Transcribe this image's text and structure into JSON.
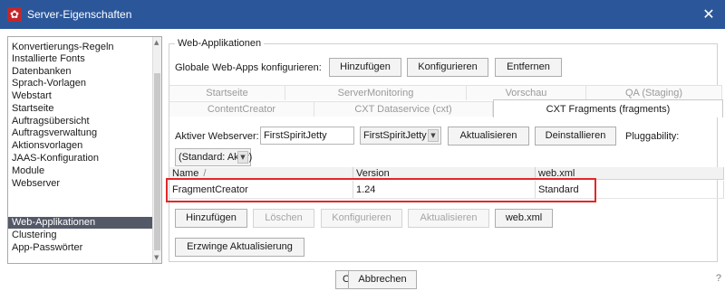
{
  "window": {
    "title": "Server-Eigenschaften",
    "close_glyph": "✕",
    "app_icon": "✿"
  },
  "sidebar": {
    "items": [
      {
        "label": "Konvertierungs-Regeln"
      },
      {
        "label": "Installierte Fonts"
      },
      {
        "label": "Datenbanken"
      },
      {
        "label": "Sprach-Vorlagen"
      },
      {
        "label": "Webstart"
      },
      {
        "label": "Startseite"
      },
      {
        "label": "Auftragsübersicht"
      },
      {
        "label": "Auftragsverwaltung"
      },
      {
        "label": "Aktionsvorlagen"
      },
      {
        "label": "JAAS-Konfiguration"
      },
      {
        "label": "Module"
      },
      {
        "label": "Webserver"
      },
      {
        "label": "Web-Applikationen",
        "selected": true
      },
      {
        "label": "Clustering"
      },
      {
        "label": "App-Passwörter"
      }
    ]
  },
  "group": {
    "legend": "Web-Applikationen"
  },
  "global": {
    "label": "Globale Web-Apps konfigurieren:",
    "add": "Hinzufügen",
    "configure": "Konfigurieren",
    "remove": "Entfernen"
  },
  "tabs_row1": [
    "Startseite",
    "ServerMonitoring",
    "Vorschau",
    "QA (Staging)"
  ],
  "tabs_row2": [
    "ContentCreator",
    "CXT Dataservice (cxt)",
    "CXT Fragments (fragments)"
  ],
  "webserver": {
    "label": "Aktiver Webserver:",
    "value": "FirstSpiritJetty",
    "combo": "FirstSpiritJetty",
    "update": "Aktualisieren",
    "uninstall": "Deinstallieren",
    "pluggability_label": "Pluggability:",
    "pluggability_value": "(Standard: Aktiv)"
  },
  "table": {
    "headers": [
      "Name",
      "Version",
      "web.xml"
    ],
    "sort_glyph": "/",
    "rows": [
      [
        "FragmentCreator",
        "1.24",
        "Standard"
      ]
    ]
  },
  "actions": {
    "add": "Hinzufügen",
    "delete": "Löschen",
    "configure": "Konfigurieren",
    "update": "Aktualisieren",
    "webxml": "web.xml",
    "force": "Erzwinge Aktualisierung"
  },
  "footer": {
    "ok": "OK",
    "cancel": "Abbrechen",
    "help": "?"
  },
  "colors": {
    "titlebar": "#2b579a",
    "selection": "#545968",
    "highlight": "#e0282a"
  },
  "icons": {
    "app": "app-icon",
    "close": "close-icon",
    "dropdown": "chevron-down-icon",
    "scroll_up": "scroll-up-icon",
    "scroll_down": "scroll-down-icon"
  }
}
